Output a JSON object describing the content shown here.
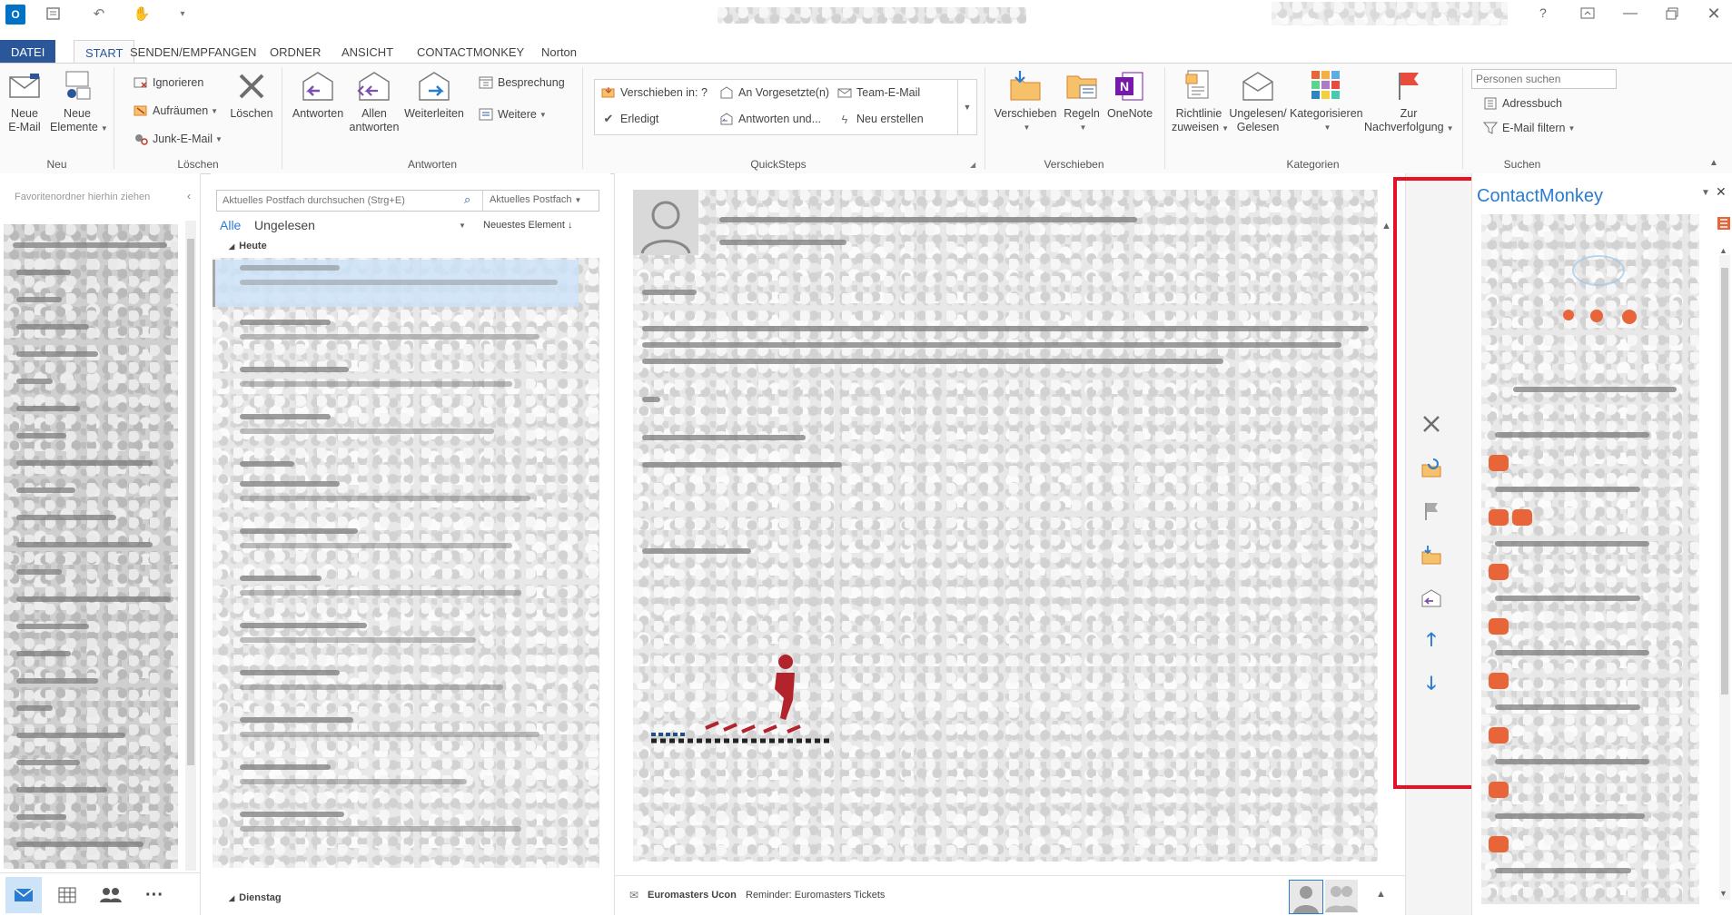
{
  "titlebar": {
    "app_icon": "O",
    "help": "?"
  },
  "tabs": [
    "DATEI",
    "START",
    "SENDEN/EMPFANGEN",
    "ORDNER",
    "ANSICHT",
    "CONTACTMONKEY",
    "Norton"
  ],
  "ribbon": {
    "neu": {
      "label": "Neu",
      "new_email": [
        "Neue",
        "E-Mail"
      ],
      "new_items": [
        "Neue",
        "Elemente"
      ]
    },
    "loeschen": {
      "label": "Löschen",
      "ignore": "Ignorieren",
      "cleanup": "Aufräumen",
      "junk": "Junk-E-Mail",
      "delete": "Löschen"
    },
    "antworten": {
      "label": "Antworten",
      "reply": "Antworten",
      "reply_all": [
        "Allen",
        "antworten"
      ],
      "forward": "Weiterleiten",
      "meeting": "Besprechung",
      "more": "Weitere"
    },
    "quicksteps": {
      "label": "QuickSteps",
      "move_to": "Verschieben in: ?",
      "to_manager": "An Vorgesetzte(n)",
      "team_email": "Team-E-Mail",
      "done": "Erledigt",
      "reply_delete": "Antworten und...",
      "create_new": "Neu erstellen"
    },
    "verschieben": {
      "label": "Verschieben",
      "move": "Verschieben",
      "rules": "Regeln",
      "onenote": "OneNote"
    },
    "kategorien": {
      "label": "Kategorien",
      "policy": [
        "Richtlinie",
        "zuweisen"
      ],
      "unread": [
        "Ungelesen/",
        "Gelesen"
      ],
      "categorize": "Kategorisieren",
      "followup": [
        "Zur",
        "Nachverfolgung"
      ]
    },
    "suchen": {
      "label": "Suchen",
      "people_placeholder": "Personen suchen",
      "address_book": "Adressbuch",
      "filter": "E-Mail filtern"
    }
  },
  "folder_pane": {
    "favorites_hint": "Favoritenordner hierhin ziehen"
  },
  "message_list": {
    "search_placeholder": "Aktuelles Postfach durchsuchen (Strg+E)",
    "scope": "Aktuelles Postfach",
    "filter_all": "Alle",
    "filter_unread": "Ungelesen",
    "sort": "Neuestes Element",
    "group_today": "Heute",
    "group_tuesday": "Dienstag"
  },
  "people_bar": {
    "sender": "Euromasters Ucon",
    "subject": "Reminder: Euromasters Tickets"
  },
  "contactmonkey": {
    "title": "ContactMonkey"
  },
  "colors": {
    "accent": "#2b579a",
    "highlight": "#e81123",
    "cm_blue": "#0072c6",
    "cm_orange": "#e8653a"
  }
}
